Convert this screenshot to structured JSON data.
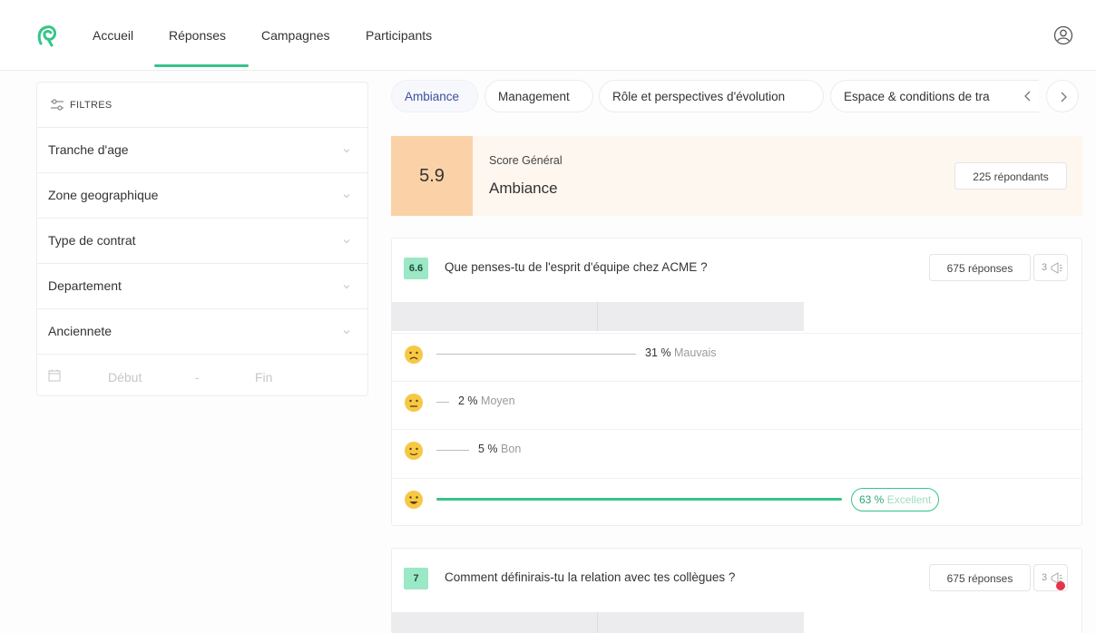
{
  "nav": {
    "items": [
      "Accueil",
      "Réponses",
      "Campagnes",
      "Participants"
    ],
    "active": "Réponses"
  },
  "filters": {
    "title": "FILTRES",
    "items": [
      "Tranche d'age",
      "Zone geographique",
      "Type de contrat",
      "Departement",
      "Anciennete"
    ],
    "date_start_placeholder": "Début",
    "date_separator": "-",
    "date_end_placeholder": "Fin"
  },
  "tabs": {
    "items": [
      "Ambiance",
      "Management",
      "Rôle et perspectives d'évolution",
      "Espace & conditions de tra"
    ],
    "active": "Ambiance"
  },
  "score": {
    "value": "5.9",
    "label": "Score Général",
    "title": "Ambiance",
    "respondents": "225 répondants"
  },
  "questions": [
    {
      "score": "6.6",
      "text": "Que penses-tu de l'esprit d'équipe chez ACME ?",
      "responses": "675 réponses",
      "comments": "3",
      "options": [
        {
          "percent": "31 %",
          "label": "Mauvais",
          "value": 31
        },
        {
          "percent": "2 %",
          "label": "Moyen",
          "value": 2
        },
        {
          "percent": "5 %",
          "label": "Bon",
          "value": 5
        },
        {
          "percent": "63 %",
          "label": "Excellent",
          "value": 63
        }
      ]
    },
    {
      "score": "7",
      "text": "Comment définirais-tu la relation avec tes collègues ?",
      "responses": "675 réponses",
      "comments": "3"
    }
  ],
  "colors": {
    "accent": "#36c48a",
    "score_box": "#fbd2a8",
    "score_bg": "#fef7ef",
    "question_score": "#9ae8c6",
    "notification": "#e5334a"
  }
}
